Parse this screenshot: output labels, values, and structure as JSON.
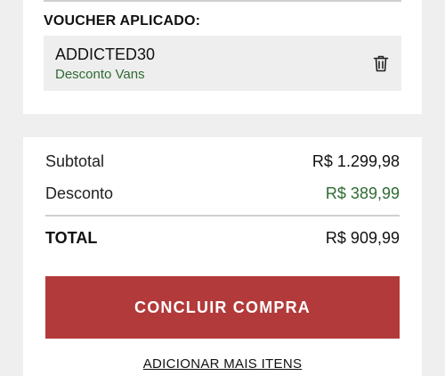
{
  "voucher": {
    "heading": "VOUCHER APLICADO:",
    "code": "ADDICTED30",
    "description": "Desconto Vans",
    "remove_icon": "trash-icon"
  },
  "summary": {
    "subtotal_label": "Subtotal",
    "subtotal_value": "R$ 1.299,98",
    "discount_label": "Desconto",
    "discount_value": "R$ 389,99",
    "total_label": "TOTAL",
    "total_value": "R$ 909,99"
  },
  "actions": {
    "checkout_label": "CONCLUIR COMPRA",
    "add_more_label": "ADICIONAR MAIS ITENS"
  },
  "colors": {
    "accent": "#b23a3a",
    "discount_green": "#2e6b34",
    "background": "#efefef",
    "card": "#ffffff",
    "voucher_box": "#eeeeee"
  }
}
